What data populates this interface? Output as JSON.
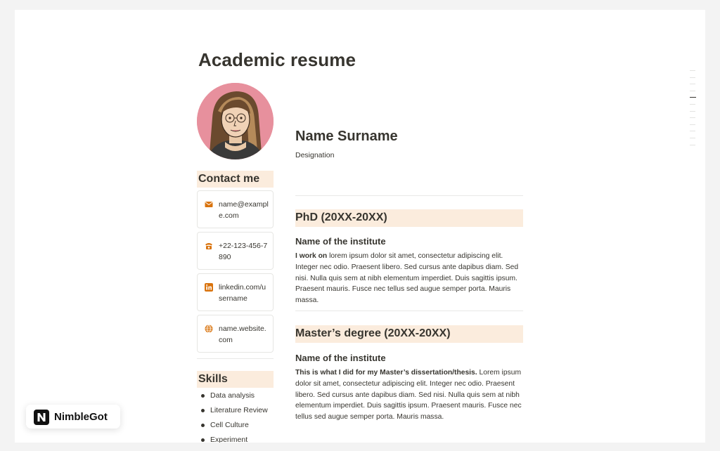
{
  "page": {
    "title": "Academic resume"
  },
  "profile": {
    "name": "Name Surname",
    "designation": "Designation"
  },
  "contact": {
    "heading": "Contact me",
    "items": [
      {
        "icon": "mail-icon",
        "text": "name@example.com"
      },
      {
        "icon": "phone-icon",
        "text": "+22-123-456-7890"
      },
      {
        "icon": "linkedin-icon",
        "text": "linkedin.com/username"
      },
      {
        "icon": "globe-icon",
        "text": "name.website.com"
      }
    ]
  },
  "skills": {
    "heading": "Skills",
    "items": [
      "Data analysis",
      "Literature Review",
      "Cell Culture",
      "Experiment"
    ]
  },
  "education": [
    {
      "degree": "PhD (20XX-20XX)",
      "institute": "Name of the institute",
      "lead": "I work on",
      "body": " lorem ipsum dolor sit amet, consectetur adipiscing elit. Integer nec odio. Praesent libero. Sed cursus ante dapibus diam. Sed nisi. Nulla quis sem at nibh elementum imperdiet. Duis sagittis ipsum. Praesent mauris. Fusce nec tellus sed augue semper porta. Mauris massa."
    },
    {
      "degree": "Master’s degree (20XX-20XX)",
      "institute": "Name of the institute",
      "lead": "This is what I did for my Master’s dissertation/thesis.",
      "body": " Lorem ipsum dolor sit amet, consectetur adipiscing elit. Integer nec odio. Praesent libero. Sed cursus ante dapibus diam. Sed nisi. Nulla quis sem at nibh elementum imperdiet. Duis sagittis ipsum. Praesent mauris. Fusce nec tellus sed augue semper porta. Mauris massa."
    }
  ],
  "brand": {
    "name": "NimbleGot"
  },
  "colors": {
    "accent_bg": "#fbecdd",
    "icon_orange": "#d9730d",
    "avatar_bg": "#e7909d",
    "text": "#37352f"
  }
}
